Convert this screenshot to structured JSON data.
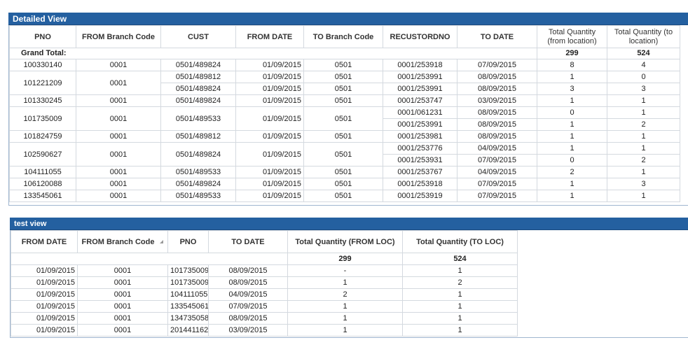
{
  "detailed_view": {
    "title": "Detailed View",
    "columns": [
      "PNO",
      "FROM Branch Code",
      "CUST",
      "FROM DATE",
      "TO Branch Code",
      "RECUSTORDNO",
      "TO DATE",
      "Total Quantity (from location)",
      "Total Quantity (to location)"
    ],
    "grand_total_label": "Grand Total:",
    "grand_total_from": "299",
    "grand_total_to": "524",
    "groups": [
      {
        "pno": "100330140",
        "branch": "0001",
        "rows": [
          [
            "0501/489824",
            "01/09/2015",
            "0501",
            "0001/253918",
            "07/09/2015",
            "8",
            "4"
          ]
        ]
      },
      {
        "pno": "101221209",
        "branch": "0001",
        "rows": [
          [
            "0501/489812",
            "01/09/2015",
            "0501",
            "0001/253991",
            "08/09/2015",
            "1",
            "0"
          ],
          [
            "0501/489824",
            "01/09/2015",
            "0501",
            "0001/253991",
            "08/09/2015",
            "3",
            "3"
          ]
        ]
      },
      {
        "pno": "101330245",
        "branch": "0001",
        "rows": [
          [
            "0501/489824",
            "01/09/2015",
            "0501",
            "0001/253747",
            "03/09/2015",
            "1",
            "1"
          ]
        ]
      },
      {
        "pno": "101735009",
        "branch": "0001",
        "cust": "0501/489533",
        "from_date": "01/09/2015",
        "to_branch": "0501",
        "rows": [
          [
            "",
            "",
            "",
            "0001/061231",
            "08/09/2015",
            "0",
            "1"
          ],
          [
            "",
            "",
            "",
            "0001/253991",
            "08/09/2015",
            "1",
            "2"
          ]
        ]
      },
      {
        "pno": "101824759",
        "branch": "0001",
        "rows": [
          [
            "0501/489812",
            "01/09/2015",
            "0501",
            "0001/253981",
            "08/09/2015",
            "1",
            "1"
          ]
        ]
      },
      {
        "pno": "102590627",
        "branch": "0001",
        "cust": "0501/489824",
        "from_date": "01/09/2015",
        "to_branch": "0501",
        "rows": [
          [
            "",
            "",
            "",
            "0001/253776",
            "04/09/2015",
            "1",
            "1"
          ],
          [
            "",
            "",
            "",
            "0001/253931",
            "07/09/2015",
            "0",
            "2"
          ]
        ]
      },
      {
        "pno": "104111055",
        "branch": "0001",
        "rows": [
          [
            "0501/489533",
            "01/09/2015",
            "0501",
            "0001/253767",
            "04/09/2015",
            "2",
            "1"
          ]
        ]
      },
      {
        "pno": "106120088",
        "branch": "0001",
        "rows": [
          [
            "0501/489824",
            "01/09/2015",
            "0501",
            "0001/253918",
            "07/09/2015",
            "1",
            "3"
          ]
        ]
      },
      {
        "pno": "133545061",
        "branch": "0001",
        "rows": [
          [
            "0501/489533",
            "01/09/2015",
            "0501",
            "0001/253919",
            "07/09/2015",
            "1",
            "1"
          ]
        ]
      }
    ]
  },
  "test_view": {
    "title": "test view",
    "columns": [
      "FROM DATE",
      "FROM Branch Code",
      "PNO",
      "TO DATE",
      "Total Quantity (FROM LOC)",
      "Total Quantity (TO LOC)"
    ],
    "total_from": "299",
    "total_to": "524",
    "rows": [
      [
        "01/09/2015",
        "0001",
        "101735009",
        "08/09/2015",
        "-",
        "1"
      ],
      [
        "01/09/2015",
        "0001",
        "101735009",
        "08/09/2015",
        "1",
        "2"
      ],
      [
        "01/09/2015",
        "0001",
        "104111055",
        "04/09/2015",
        "2",
        "1"
      ],
      [
        "01/09/2015",
        "0001",
        "133545061",
        "07/09/2015",
        "1",
        "1"
      ],
      [
        "01/09/2015",
        "0001",
        "134735058",
        "08/09/2015",
        "1",
        "1"
      ],
      [
        "01/09/2015",
        "0001",
        "201441162",
        "03/09/2015",
        "1",
        "1"
      ]
    ]
  }
}
